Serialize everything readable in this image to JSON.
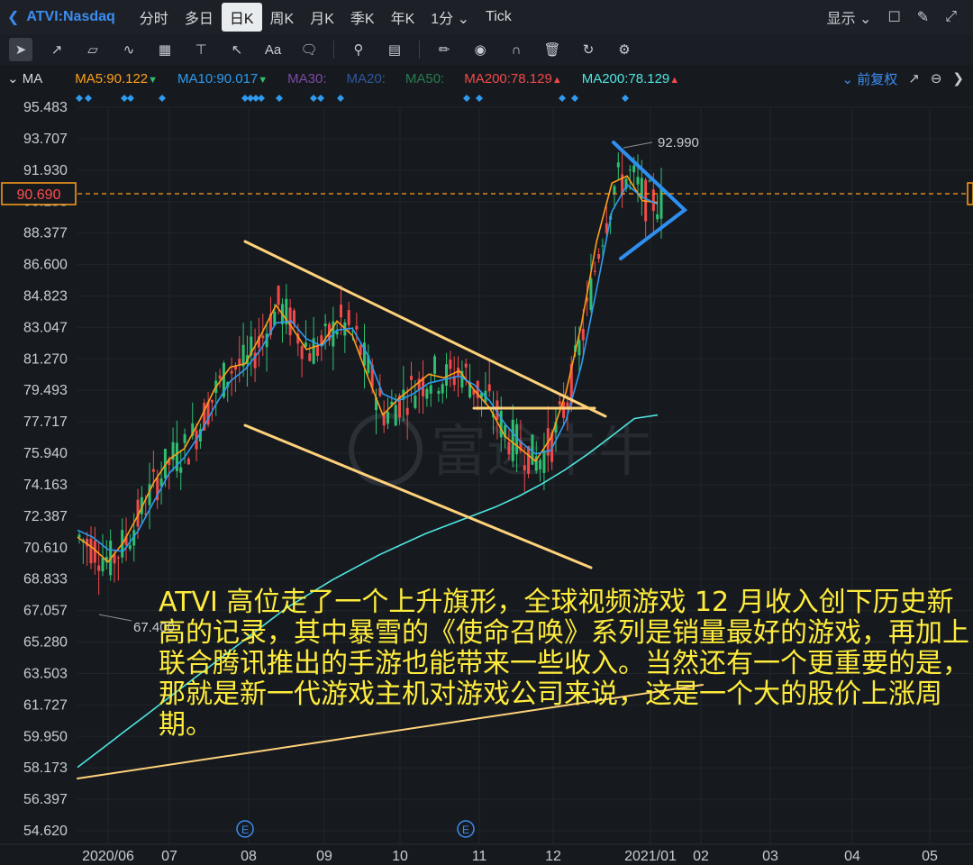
{
  "topbar": {
    "symbol": "ATVI:Nasdaq",
    "periods": [
      "分时",
      "多日",
      "日K",
      "周K",
      "月K",
      "季K",
      "年K",
      "1分"
    ],
    "active_period": "日K",
    "extra": "Tick",
    "display_label": "显示"
  },
  "toolbar": {
    "tools": [
      "cursor-icon",
      "line-icon",
      "polyline-icon",
      "wave-icon",
      "grid-icon",
      "level-icon",
      "arrow-icon",
      "text-icon",
      "comment-icon",
      "search-icon",
      "indicator-icon",
      "pen-icon",
      "eye-icon",
      "magnet-icon",
      "trash-icon",
      "sync-icon",
      "gear-icon"
    ],
    "text_tool_label": "Aa"
  },
  "ma_bar": {
    "label": "MA",
    "items": [
      {
        "text": "MA5:90.122",
        "color": "#ff9f1a",
        "arrow": "▼",
        "arrow_color": "#2fbf71"
      },
      {
        "text": "MA10:90.017",
        "color": "#2e9bf0",
        "arrow": "▼",
        "arrow_color": "#2fbf71"
      },
      {
        "text": "MA30:",
        "color": "#a05ad6",
        "arrow": "",
        "arrow_color": ""
      },
      {
        "text": "MA20:",
        "color": "#3b6cc4",
        "arrow": "",
        "arrow_color": ""
      },
      {
        "text": "MA50:",
        "color": "#2f8f5a",
        "arrow": "",
        "arrow_color": ""
      },
      {
        "text": "MA200:78.129",
        "color": "#f24a4a",
        "arrow": "▲",
        "arrow_color": "#f24a4a"
      },
      {
        "text": "MA200:78.129",
        "color": "#4fe6e0",
        "arrow": "▲",
        "arrow_color": "#f24a4a"
      }
    ],
    "adjust_label": "前复权"
  },
  "chart_data": {
    "type": "candlestick",
    "title": "",
    "y_ticks": [
      95.483,
      93.707,
      91.93,
      90.153,
      88.377,
      86.6,
      84.823,
      83.047,
      81.27,
      79.493,
      77.717,
      75.94,
      74.163,
      72.387,
      70.61,
      68.833,
      67.057,
      65.28,
      63.503,
      61.727,
      59.95,
      58.173,
      56.397,
      54.62
    ],
    "ylim": [
      53.8,
      97.0
    ],
    "x_ticks": [
      "2020/06",
      "07",
      "08",
      "09",
      "10",
      "11",
      "12",
      "2021/01",
      "02",
      "03",
      "04",
      "05"
    ],
    "current_price": "90.690",
    "high_label": "92.990",
    "low_label": "67.400",
    "event_markers": [
      "E",
      "E"
    ],
    "watermark": "富途牛牛",
    "series": [
      {
        "name": "MA5",
        "color": "#ff9f1a",
        "values": [
          71.2,
          70.6,
          69.8,
          70.9,
          72.5,
          74.3,
          75.6,
          76.2,
          77.8,
          79.6,
          80.8,
          81.0,
          82.6,
          84.3,
          83.1,
          81.8,
          82.1,
          83.4,
          82.6,
          80.3,
          78.1,
          79.0,
          79.7,
          80.4,
          80.2,
          80.6,
          79.5,
          78.5,
          76.9,
          76.2,
          75.5,
          76.8,
          79.4,
          83.2,
          87.9,
          91.2,
          91.6,
          90.2,
          90.1
        ]
      },
      {
        "name": "MA10",
        "color": "#2e9bf0",
        "values": [
          71.6,
          71.2,
          70.5,
          70.4,
          71.6,
          73.2,
          74.8,
          75.7,
          77.0,
          78.6,
          80.0,
          80.7,
          81.8,
          83.3,
          83.4,
          82.4,
          82.0,
          82.9,
          83.0,
          81.5,
          79.3,
          78.9,
          79.3,
          79.9,
          80.1,
          80.3,
          79.8,
          78.9,
          77.6,
          76.6,
          75.9,
          76.1,
          77.8,
          80.9,
          85.2,
          89.6,
          91.1,
          90.4,
          90.0
        ]
      },
      {
        "name": "MA200",
        "color": "#4fe6e0",
        "values": [
          58.2,
          59.2,
          60.2,
          61.2,
          62.2,
          63.2,
          64.2,
          65.2,
          66.2,
          67.2,
          68.0,
          68.8,
          69.5,
          70.2,
          70.8,
          71.4,
          71.9,
          72.4,
          72.9,
          73.5,
          74.2,
          75.0,
          75.9,
          76.9,
          77.9,
          78.1
        ]
      }
    ]
  },
  "annotation": "ATVI 高位走了一个上升旗形，全球视频游戏 12 月收入创下历史新高的记录，其中暴雪的《使命召唤》系列是销量最好的游戏，再加上联合腾讯推出的手游也能带来一些收入。当然还有一个更重要的是，那就是新一代游戏主机对游戏公司来说，这是一个大的股价上涨周期。"
}
